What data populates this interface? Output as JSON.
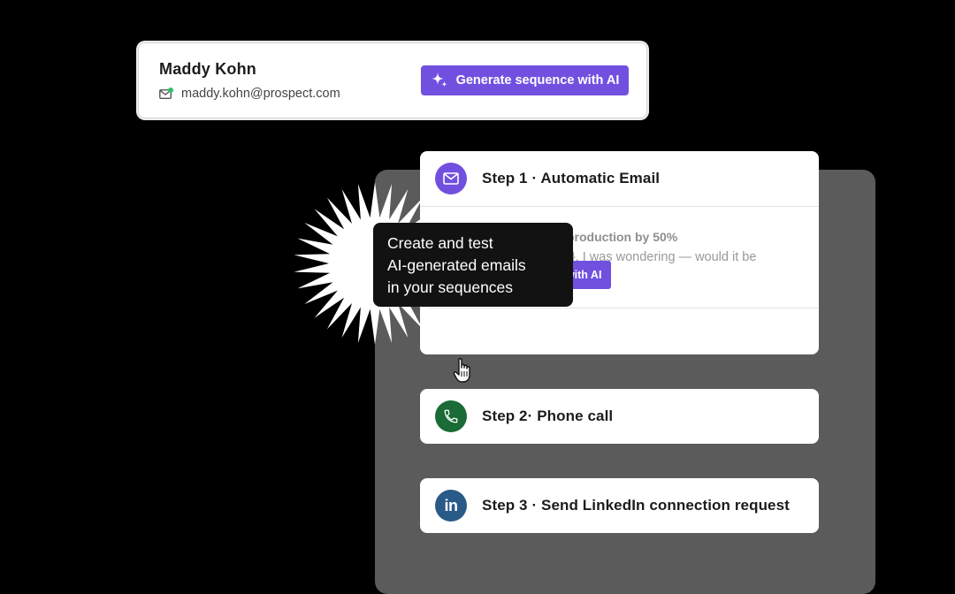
{
  "contact": {
    "name": "Maddy Kohn",
    "email": "maddy.kohn@prospect.com",
    "generate_button_label": "Generate sequence with AI"
  },
  "steps": [
    {
      "title": "Step 1 · Automatic Email",
      "icon": "mail-icon",
      "icon_color": "#7150e0",
      "email_subject": "production by 50%",
      "email_snippet": "}}, I was wondering — would it be",
      "personalize_button_label": "Personalize email with AI"
    },
    {
      "title": "Step 2· Phone call",
      "icon": "phone-icon",
      "icon_color": "#1a6b35"
    },
    {
      "title": "Step 3 · Send LinkedIn connection request",
      "icon": "linkedin-icon",
      "icon_color": "#2a5a88",
      "icon_text": "in"
    }
  ],
  "tooltip": {
    "lines": [
      "Create and test",
      "AI-generated emails",
      "in your sequences"
    ]
  },
  "colors": {
    "accent": "#7150e0",
    "online_status": "#2ec26b",
    "panel_background": "#5b5b5b"
  }
}
